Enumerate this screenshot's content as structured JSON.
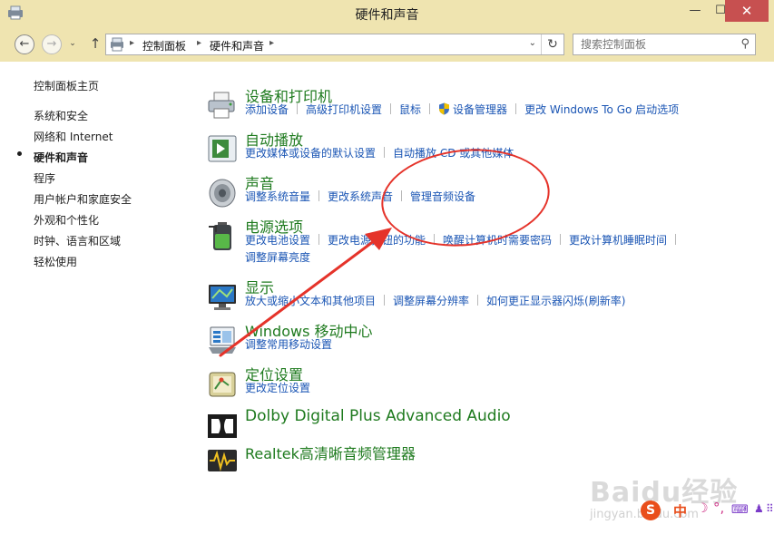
{
  "window": {
    "title": "硬件和声音",
    "minimize_glyph": "—",
    "maximize_glyph": "☐",
    "close_glyph": "✕"
  },
  "nav": {
    "back_glyph": "←",
    "forward_glyph": "→",
    "recent_glyph": "⌄",
    "up_glyph": "↑",
    "breadcrumb": [
      "控制面板",
      "硬件和声音"
    ],
    "refresh_glyph": "↻",
    "dropdown_glyph": "⌄",
    "search_placeholder": "搜索控制面板",
    "search_icon": "⚲"
  },
  "sidebar": {
    "items": [
      {
        "label": "控制面板主页"
      },
      {
        "label": "系统和安全"
      },
      {
        "label": "网络和 Internet"
      },
      {
        "label": "硬件和声音"
      },
      {
        "label": "程序"
      },
      {
        "label": "用户帐户和家庭安全"
      },
      {
        "label": "外观和个性化"
      },
      {
        "label": "时钟、语言和区域"
      },
      {
        "label": "轻松使用"
      }
    ]
  },
  "categories": [
    {
      "title": "设备和打印机",
      "icon": "printer-icon",
      "links": [
        "添加设备",
        "高级打印机设置",
        "鼠标",
        "设备管理器",
        "更改 Windows To Go 启动选项"
      ]
    },
    {
      "title": "自动播放",
      "icon": "autoplay-icon",
      "links": [
        "更改媒体或设备的默认设置",
        "自动播放 CD 或其他媒体"
      ]
    },
    {
      "title": "声音",
      "icon": "speaker-icon",
      "links": [
        "调整系统音量",
        "更改系统声音",
        "管理音频设备"
      ]
    },
    {
      "title": "电源选项",
      "icon": "battery-icon",
      "links": [
        "更改电池设置",
        "更改电源按钮的功能",
        "唤醒计算机时需要密码",
        "更改计算机睡眠时间",
        "调整屏幕亮度"
      ]
    },
    {
      "title": "显示",
      "icon": "display-icon",
      "links": [
        "放大或缩小文本和其他项目",
        "调整屏幕分辨率",
        "如何更正显示器闪烁(刷新率)"
      ]
    },
    {
      "title": "Windows 移动中心",
      "icon": "mobility-center-icon",
      "links": [
        "调整常用移动设置"
      ]
    },
    {
      "title": "定位设置",
      "icon": "location-icon",
      "links": [
        "更改定位设置"
      ]
    },
    {
      "title": "Dolby Digital Plus Advanced Audio",
      "icon": "dolby-icon",
      "links": []
    },
    {
      "title": "Realtek高清晰音频管理器",
      "icon": "realtek-icon",
      "links": []
    }
  ],
  "overlay": {
    "watermark": "Baidu经验",
    "watermark_url": "jingyan.baidu.com",
    "ime_logo": "S",
    "ime_mode": "中",
    "ime_moon": "☽",
    "ime_punc": "°,",
    "ime_keyboard": "⌨",
    "ime_person": "♟",
    "ime_grid": "⠿"
  },
  "colors": {
    "titlebar": "#efe4b0",
    "category_title": "#1e7a1e",
    "link": "#1a55b4",
    "annotation": "#e5332a"
  }
}
